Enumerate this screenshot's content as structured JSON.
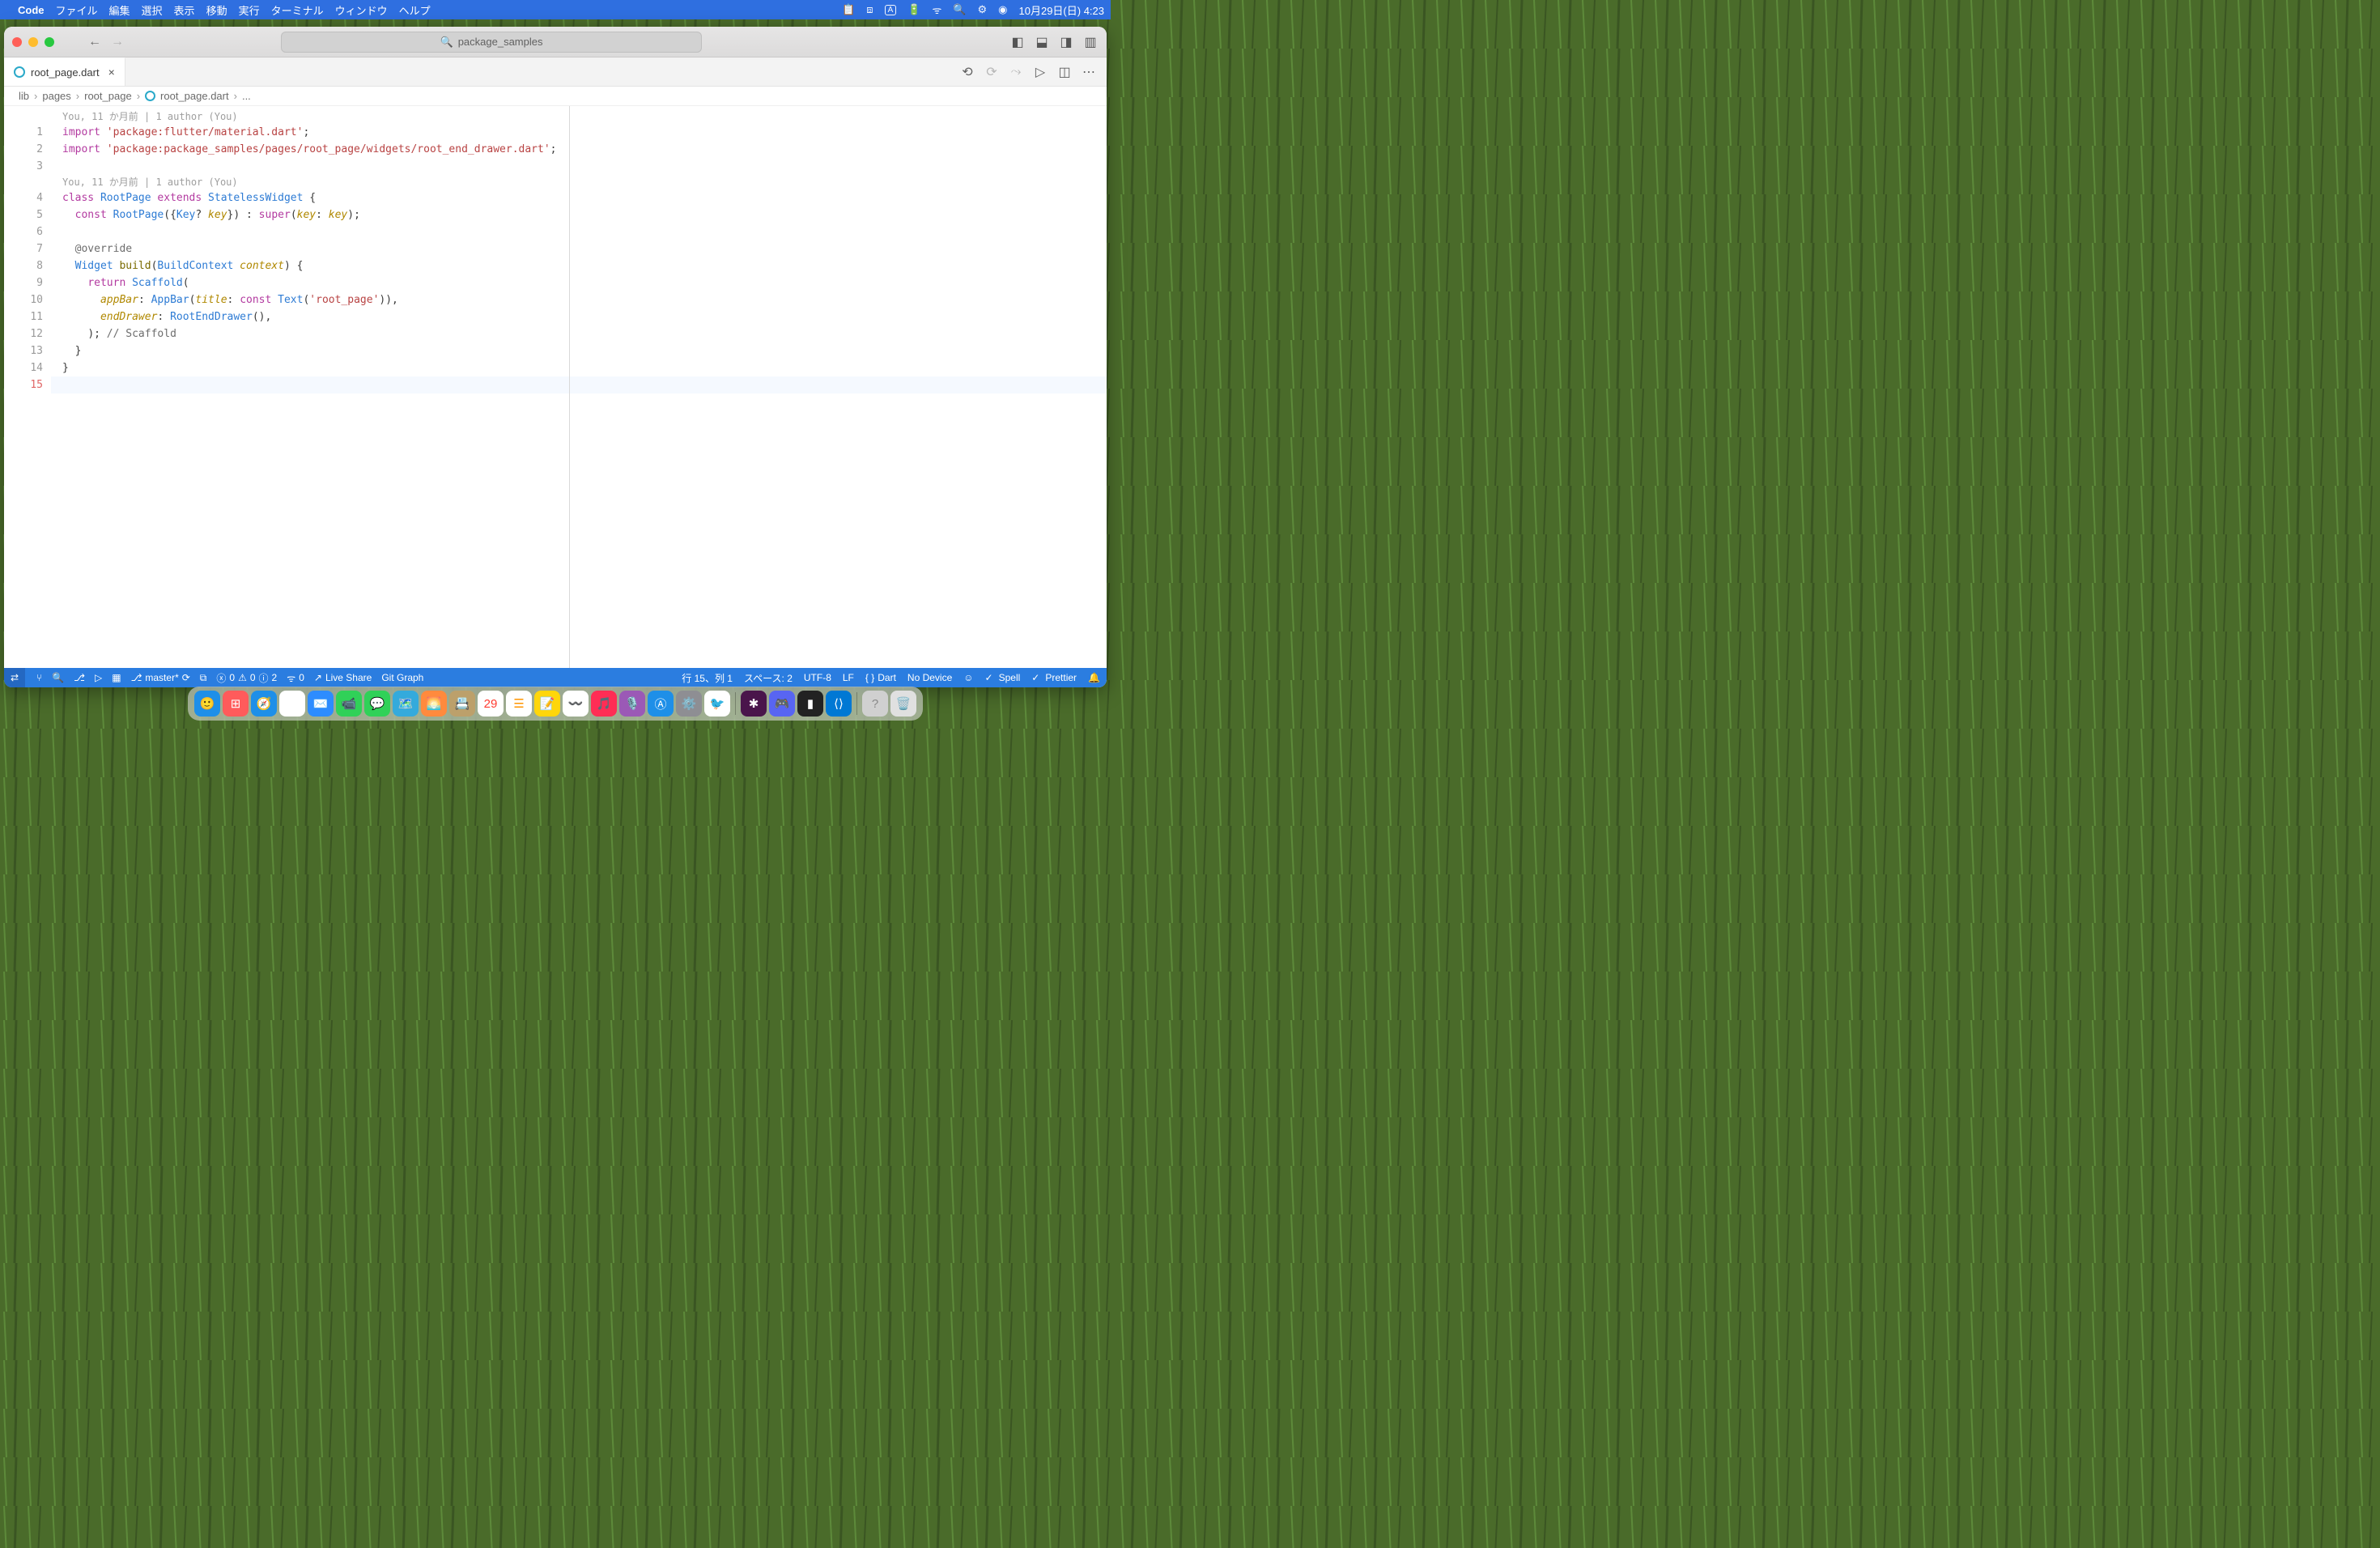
{
  "menubar": {
    "app": "Code",
    "items": [
      "ファイル",
      "編集",
      "選択",
      "表示",
      "移動",
      "実行",
      "ターミナル",
      "ウィンドウ",
      "ヘルプ"
    ],
    "clock": "10月29日(日)  4:23"
  },
  "titlebar": {
    "search": "package_samples"
  },
  "tab": {
    "label": "root_page.dart"
  },
  "breadcrumb": {
    "parts": [
      "lib",
      "pages",
      "root_page",
      "root_page.dart",
      "..."
    ]
  },
  "codelens": {
    "top": "You, 11 か月前 | 1 author (You)",
    "cls": "You, 11 か月前 | 1 author (You)"
  },
  "code": {
    "l1": {
      "kw": "import",
      "str": "'package:flutter/material.dart'",
      "end": ";"
    },
    "l2": {
      "kw": "import",
      "str": "'package:package_samples/pages/root_page/widgets/root_end_drawer.dart'",
      "end": ";"
    },
    "l4": {
      "kw1": "class",
      "name": "RootPage",
      "kw2": "extends",
      "base": "StatelessWidget",
      "br": "{"
    },
    "l5": {
      "kw": "const",
      "name": "RootPage",
      "p": "({",
      "key1": "Key",
      "q": "?",
      "key2": " key",
      "p2": "}) : ",
      "sup": "super",
      "p3": "(",
      "key3": "key",
      "p4": ": ",
      "key4": "key",
      "p5": ");"
    },
    "l7": {
      "ann": "@override"
    },
    "l8": {
      "t": "Widget",
      "fn": " build",
      "p": "(",
      "bc": "BuildContext",
      "ctx": " context",
      "p2": ") {"
    },
    "l9": {
      "kw": "return",
      "sc": " Scaffold",
      "p": "("
    },
    "l10": {
      "k": "appBar",
      "p": ": ",
      "t": "AppBar",
      "p2": "(",
      "k2": "title",
      "p3": ": ",
      "kw": "const",
      "t2": " Text",
      "p4": "(",
      "str": "'root_page'",
      "p5": ")),"
    },
    "l11": {
      "k": "endDrawer",
      "p": ": ",
      "t": "RootEndDrawer",
      "p2": "(),"
    },
    "l12": {
      "p": "); ",
      "cmt": "// Scaffold"
    },
    "l13": {
      "p": "}"
    },
    "l14": {
      "p": "}"
    }
  },
  "lines": [
    "1",
    "2",
    "3",
    "4",
    "5",
    "6",
    "7",
    "8",
    "9",
    "10",
    "11",
    "12",
    "13",
    "14",
    "15"
  ],
  "status": {
    "branch": "master*",
    "errors": "0",
    "warns": "0",
    "info": "2",
    "radio": "0",
    "live": "Live Share",
    "git": "Git Graph",
    "pos": "行 15、列 1",
    "spaces": "スペース: 2",
    "enc": "UTF-8",
    "eol": "LF",
    "lang": "Dart",
    "device": "No Device",
    "spell": "Spell",
    "prettier": "Prettier"
  }
}
